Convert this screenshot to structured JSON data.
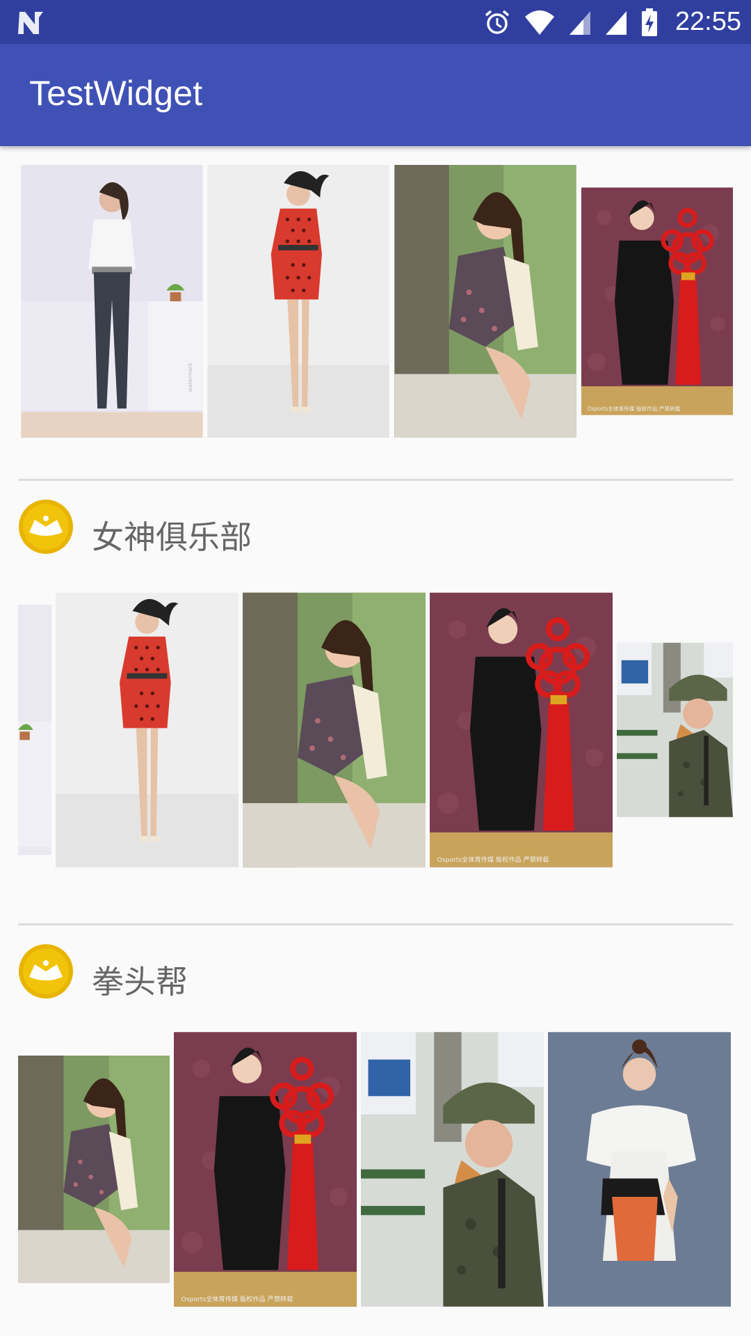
{
  "status_bar": {
    "time": "22:55"
  },
  "app_bar": {
    "title": "TestWidget"
  },
  "sections": [
    {
      "title": "女神俱乐部",
      "icon": "crown-icon"
    },
    {
      "title": "拳头帮",
      "icon": "crown-icon"
    }
  ],
  "photos": {
    "white_blouse_jeans": {
      "subject": "woman in white blouse and dark jeans"
    },
    "red_polka_dress": {
      "subject": "woman in red polka dot dress"
    },
    "floral_dress_tree": {
      "subject": "woman in floral dress by tree"
    },
    "black_outfit_knot": {
      "subject": "woman in black holding red chinese knot"
    },
    "soldier_helmet": {
      "subject": "woman in soldier helmet and camouflage"
    },
    "white_fur": {
      "subject": "woman in white fur stole"
    }
  },
  "colors": {
    "status_bar": "#303f9f",
    "app_bar": "#3f51b5",
    "crown_badge": "#e8b400",
    "background": "#fafafa"
  }
}
